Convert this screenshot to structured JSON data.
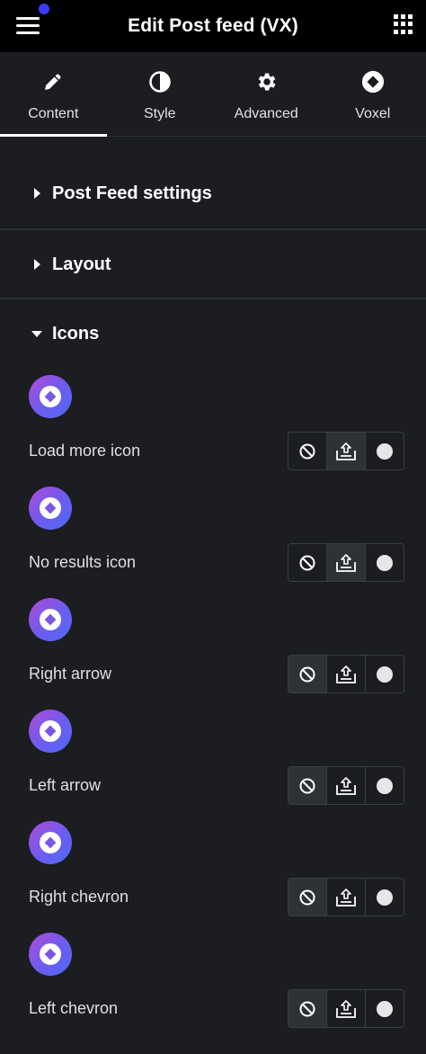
{
  "header": {
    "title": "Edit Post feed (VX)"
  },
  "tabs": [
    {
      "label": "Content",
      "icon": "pencil-icon",
      "active": true
    },
    {
      "label": "Style",
      "icon": "contrast-icon",
      "active": false
    },
    {
      "label": "Advanced",
      "icon": "gear-icon",
      "active": false
    },
    {
      "label": "Voxel",
      "icon": "voxel-logo-icon",
      "active": false
    }
  ],
  "sections": {
    "post_feed_settings": "Post Feed settings",
    "layout": "Layout",
    "icons": "Icons"
  },
  "icon_controls": [
    {
      "label": "Load more icon",
      "selected": "upload"
    },
    {
      "label": "No results icon",
      "selected": "upload"
    },
    {
      "label": "Right arrow",
      "selected": "none"
    },
    {
      "label": "Left arrow",
      "selected": "none"
    },
    {
      "label": "Right chevron",
      "selected": "none"
    },
    {
      "label": "Left chevron",
      "selected": "none"
    }
  ],
  "colors": {
    "topbar": "#000000",
    "panel": "#1b1d21",
    "notification_dot": "#3a3dff",
    "gradient_start": "#b04bd6",
    "gradient_end": "#4d6bf5"
  }
}
